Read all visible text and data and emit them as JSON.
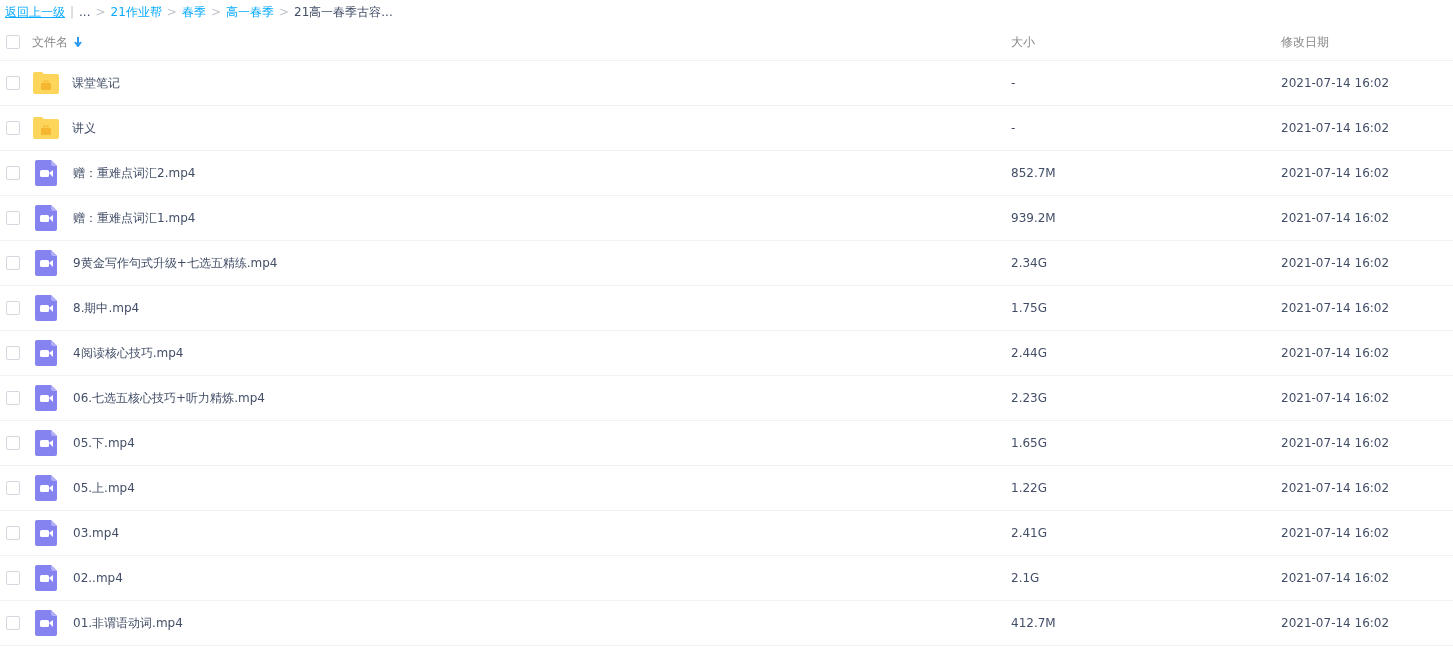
{
  "breadcrumb": {
    "back": "返回上一级",
    "divider": "|",
    "items": [
      {
        "label": "...",
        "link": false
      },
      {
        "label": "21作业帮",
        "separator": ">",
        "link": true
      },
      {
        "label": "春季",
        "separator": ">",
        "link": true
      },
      {
        "label": "高一春季",
        "separator": ">",
        "link": true
      },
      {
        "label": "21高一春季古容...",
        "separator": ">",
        "link": false
      }
    ]
  },
  "table": {
    "select_all": {
      "checked": false
    },
    "columns": [
      {
        "label": "文件名"
      },
      {
        "label": "大小"
      },
      {
        "label": "修改日期"
      }
    ],
    "rows": [
      {
        "kind": "folder",
        "name": "课堂笔记",
        "size": "-",
        "modified": "2021-07-14 16:02",
        "checked": false
      },
      {
        "kind": "folder",
        "name": "讲义",
        "size": "-",
        "modified": "2021-07-14 16:02",
        "checked": false
      },
      {
        "kind": "video",
        "name": "赠：重难点词汇2.mp4",
        "size": "852.7M",
        "modified": "2021-07-14 16:02",
        "checked": false
      },
      {
        "kind": "video",
        "name": "赠：重难点词汇1.mp4",
        "size": "939.2M",
        "modified": "2021-07-14 16:02",
        "checked": false
      },
      {
        "kind": "video",
        "name": "9黄金写作句式升级+七选五精练.mp4",
        "size": "2.34G",
        "modified": "2021-07-14 16:02",
        "checked": false
      },
      {
        "kind": "video",
        "name": "8.期中.mp4",
        "size": "1.75G",
        "modified": "2021-07-14 16:02",
        "checked": false
      },
      {
        "kind": "video",
        "name": "4阅读核心技巧.mp4",
        "size": "2.44G",
        "modified": "2021-07-14 16:02",
        "checked": false
      },
      {
        "kind": "video",
        "name": "06.七选五核心技巧+听力精炼.mp4",
        "size": "2.23G",
        "modified": "2021-07-14 16:02",
        "checked": false
      },
      {
        "kind": "video",
        "name": "05.下.mp4",
        "size": "1.65G",
        "modified": "2021-07-14 16:02",
        "checked": false
      },
      {
        "kind": "video",
        "name": "05.上.mp4",
        "size": "1.22G",
        "modified": "2021-07-14 16:02",
        "checked": false
      },
      {
        "kind": "video",
        "name": "03.mp4",
        "size": "2.41G",
        "modified": "2021-07-14 16:02",
        "checked": false
      },
      {
        "kind": "video",
        "name": "02..mp4",
        "size": "2.1G",
        "modified": "2021-07-14 16:02",
        "checked": false
      },
      {
        "kind": "video",
        "name": "01.非谓语动词.mp4",
        "size": "412.7M",
        "modified": "2021-07-14 16:02",
        "checked": false
      }
    ]
  }
}
